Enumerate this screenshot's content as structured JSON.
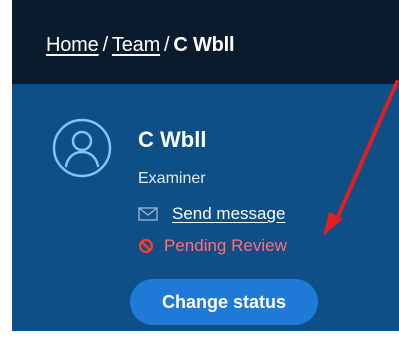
{
  "breadcrumb": {
    "home": "Home",
    "team": "Team",
    "current": "C Wbll",
    "separator": "/"
  },
  "profile": {
    "name": "C Wbll",
    "role": "Examiner",
    "message_link": "Send message",
    "status": "Pending Review",
    "change_status_label": "Change status"
  },
  "icons": {
    "avatar": "user-avatar-icon",
    "mail": "envelope-icon",
    "status": "blocked-icon"
  },
  "colors": {
    "header_bg": "#0b1b2e",
    "panel_bg": "#0d4f86",
    "button_bg": "#1e7ad6",
    "status_text": "#ff6f78",
    "annotation_arrow": "#e02020"
  }
}
